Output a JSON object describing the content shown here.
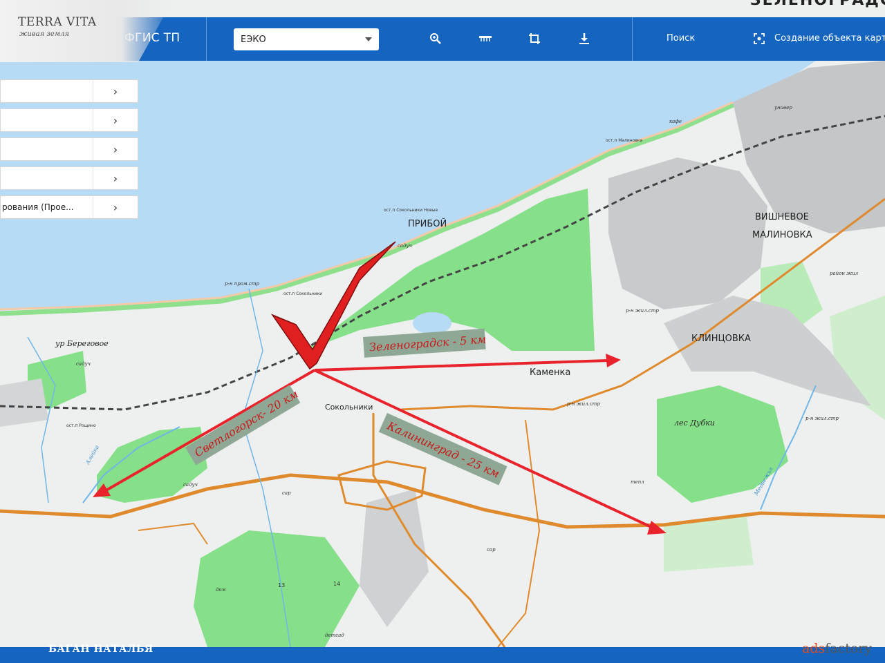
{
  "header": {
    "logo_main": "TERRA VITA",
    "logo_sub": "живая земля",
    "app_title": "стема ФГИС ТП",
    "layer_select": "ЕЭКО",
    "search_link": "Поиск",
    "create_link": "Создание объекта карты",
    "city_top": "ЗЕЛЕНОГРАДСК"
  },
  "sidebar": {
    "items": [
      {
        "label": ""
      },
      {
        "label": ""
      },
      {
        "label": ""
      },
      {
        "label": ""
      },
      {
        "label": "рования (Прое..."
      }
    ]
  },
  "map": {
    "places": {
      "priboy": "ПРИБОЙ",
      "vishnevoe": "ВИШНЕВОЕ",
      "malinovka": "МАЛИНОВКА",
      "klincovka": "КЛИНЦОВКА",
      "kamenka": "Каменка",
      "sokolniki": "Сокольники",
      "beregovoe": "ур Береговое",
      "les_dubki": "лес Дубки",
      "st_sokolniki_new": "ост.п Сокольники Новые",
      "st_sokolniki": "ост.п Сокольники",
      "st_malinovka": "ост.п Малиновка",
      "st_roschino": "ост.п Рощино",
      "rn_promstr": "р-н пром.стр",
      "rn_zhilstr": "р-н жил.стр",
      "sadych": "садуч",
      "raion_zhil": "район жил",
      "kafe": "кафе",
      "univer": "универ",
      "sar": "сар",
      "dom": "дом",
      "detsad": "детсад",
      "tepl": "тепл",
      "alleya": "Алейка",
      "medvezhya": "Медвежья",
      "num13": "13",
      "num14": "14"
    },
    "arrows": {
      "zelenogradsk": "Зеленоградск - 5 км",
      "svetlogorsk": "Светлогорск- 20 км",
      "kaliningrad": "Калининград - 25 км"
    },
    "colors": {
      "sea": "#b7daf5",
      "land": "#eef0f0",
      "forest": "#86e08a",
      "forest_light": "#cfeecd",
      "road": "#e08a2e",
      "arrow": "#e8232b",
      "check": "#e02020",
      "label_bg": "#8fa895"
    }
  },
  "footer": {
    "author": "БАГАН НАТАЛЬЯ",
    "watermark_a": "ads",
    "watermark_b": "factory"
  }
}
